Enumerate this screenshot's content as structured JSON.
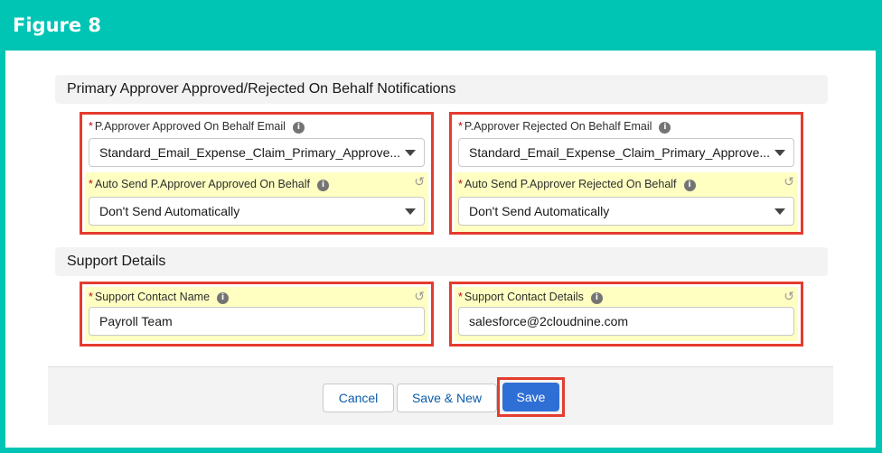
{
  "figure": {
    "title": "Figure 8"
  },
  "sections": {
    "notifications": {
      "title": "Primary Approver Approved/Rejected On Behalf Notifications"
    },
    "support": {
      "title": "Support Details"
    }
  },
  "fields": {
    "approved_email": {
      "label": "P.Approver Approved On Behalf Email",
      "value": "Standard_Email_Expense_Claim_Primary_Approve..."
    },
    "rejected_email": {
      "label": "P.Approver Rejected On Behalf Email",
      "value": "Standard_Email_Expense_Claim_Primary_Approve..."
    },
    "auto_approved": {
      "label": "Auto Send P.Approver Approved On Behalf",
      "value": "Don't Send Automatically"
    },
    "auto_rejected": {
      "label": "Auto Send P.Approver Rejected On Behalf",
      "value": "Don't Send Automatically"
    },
    "contact_name": {
      "label": "Support Contact Name",
      "value": "Payroll Team"
    },
    "contact_details": {
      "label": "Support Contact Details",
      "value": "salesforce@2cloudnine.com"
    }
  },
  "common": {
    "required_mark": "*",
    "info_glyph": "i",
    "undo_glyph": "↺"
  },
  "footer": {
    "cancel_label": "Cancel",
    "save_new_label": "Save & New",
    "save_label": "Save"
  },
  "colors": {
    "teal_frame": "#00c4b4",
    "highlight_border": "#e43c2f",
    "edited_field": "#ffffc2",
    "save_button": "#2e6fd6"
  },
  "icons": {
    "info": "info-icon",
    "undo": "undo-icon",
    "dropdown": "chevron-down-icon"
  }
}
